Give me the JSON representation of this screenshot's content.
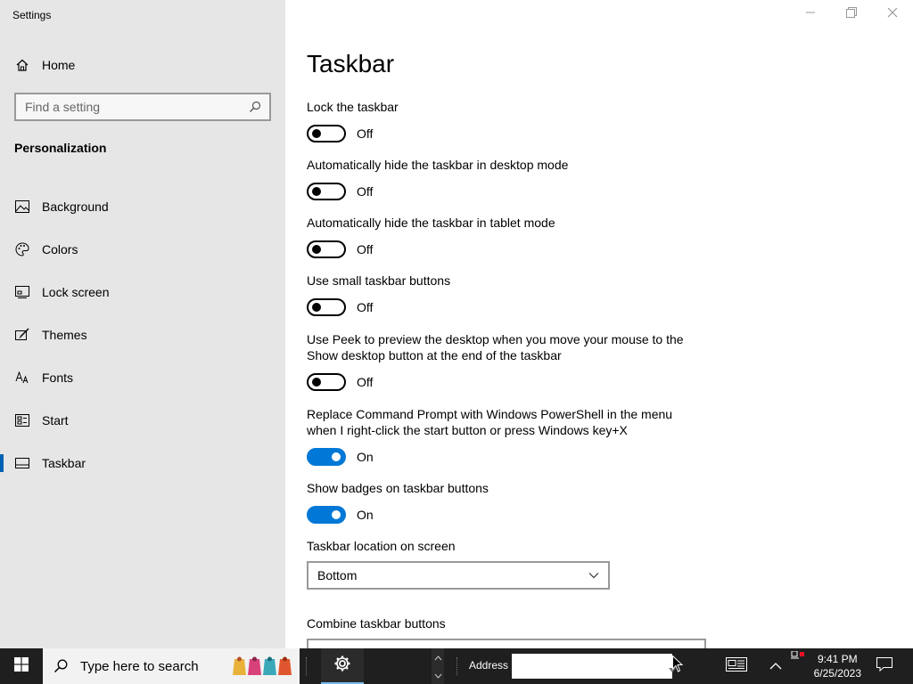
{
  "window": {
    "app_title": "Settings",
    "controls": [
      "minimize-icon",
      "restore-icon",
      "close-icon"
    ]
  },
  "sidebar": {
    "home_label": "Home",
    "search_placeholder": "Find a setting",
    "section_title": "Personalization",
    "items": [
      {
        "label": "Background",
        "icon": "picture-icon",
        "active": false
      },
      {
        "label": "Colors",
        "icon": "palette-icon",
        "active": false
      },
      {
        "label": "Lock screen",
        "icon": "lock-screen-icon",
        "active": false
      },
      {
        "label": "Themes",
        "icon": "brush-icon",
        "active": false
      },
      {
        "label": "Fonts",
        "icon": "font-icon",
        "active": false
      },
      {
        "label": "Start",
        "icon": "start-icon",
        "active": false
      },
      {
        "label": "Taskbar",
        "icon": "taskbar-icon",
        "active": true
      }
    ]
  },
  "main": {
    "title": "Taskbar",
    "settings": [
      {
        "label": "Lock the taskbar",
        "state": "Off",
        "on": false
      },
      {
        "label": "Automatically hide the taskbar in desktop mode",
        "state": "Off",
        "on": false
      },
      {
        "label": "Automatically hide the taskbar in tablet mode",
        "state": "Off",
        "on": false
      },
      {
        "label": "Use small taskbar buttons",
        "state": "Off",
        "on": false
      },
      {
        "label": "Use Peek to preview the desktop when you move your mouse to the Show desktop button at the end of the taskbar",
        "state": "Off",
        "on": false
      },
      {
        "label": "Replace Command Prompt with Windows PowerShell in the menu when I right-click the start button or press Windows key+X",
        "state": "On",
        "on": true
      },
      {
        "label": "Show badges on taskbar buttons",
        "state": "On",
        "on": true
      }
    ],
    "location": {
      "label": "Taskbar location on screen",
      "value": "Bottom"
    },
    "combine": {
      "label": "Combine taskbar buttons"
    }
  },
  "taskbar": {
    "search_placeholder": "Type here to search",
    "address_label": "Address",
    "address_value": "",
    "time": "9:41 PM",
    "date": "6/25/2023"
  },
  "colors": {
    "accent": "#0078d7",
    "sidebar_bg": "#e6e6e6",
    "taskbar_bg": "#1f1f1f"
  }
}
